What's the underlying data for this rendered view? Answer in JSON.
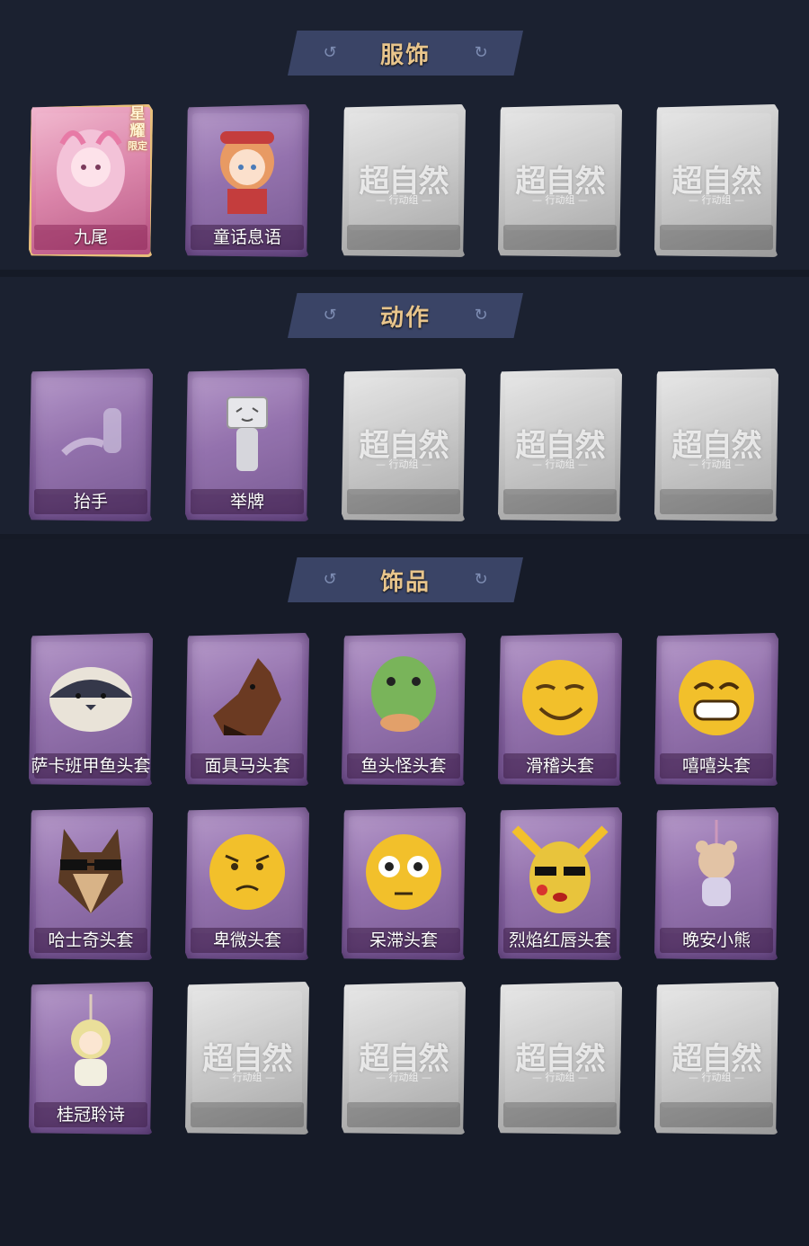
{
  "sections": [
    {
      "title": "服饰",
      "items": [
        {
          "name": "九尾",
          "state": "owned",
          "badge": [
            "星",
            "耀",
            "限定"
          ],
          "icon": "nine-tails-costume-icon"
        },
        {
          "name": "童话息语",
          "state": "owned",
          "icon": "fairy-tale-costume-icon"
        },
        {
          "name": "",
          "state": "locked"
        },
        {
          "name": "",
          "state": "locked"
        },
        {
          "name": "",
          "state": "locked"
        }
      ]
    },
    {
      "title": "动作",
      "items": [
        {
          "name": "抬手",
          "state": "owned",
          "icon": "raise-hand-action-icon"
        },
        {
          "name": "举牌",
          "state": "owned",
          "icon": "hold-sign-action-icon"
        },
        {
          "name": "",
          "state": "locked"
        },
        {
          "name": "",
          "state": "locked"
        },
        {
          "name": "",
          "state": "locked"
        }
      ]
    },
    {
      "title": "饰品",
      "items": [
        {
          "name": "萨卡班甲鱼头套",
          "state": "owned",
          "icon": "sacabambaspis-head-icon"
        },
        {
          "name": "面具马头套",
          "state": "owned",
          "icon": "horse-mask-icon"
        },
        {
          "name": "鱼头怪头套",
          "state": "owned",
          "icon": "fish-head-icon"
        },
        {
          "name": "滑稽头套",
          "state": "owned",
          "icon": "funny-face-icon"
        },
        {
          "name": "嘻嘻头套",
          "state": "owned",
          "icon": "grin-face-icon"
        },
        {
          "name": "哈士奇头套",
          "state": "owned",
          "icon": "husky-head-icon"
        },
        {
          "name": "卑微头套",
          "state": "owned",
          "icon": "humble-face-icon"
        },
        {
          "name": "呆滞头套",
          "state": "owned",
          "icon": "dazed-face-icon"
        },
        {
          "name": "烈焰红唇头套",
          "state": "owned",
          "icon": "red-lips-head-icon"
        },
        {
          "name": "晚安小熊",
          "state": "owned",
          "icon": "bear-charm-icon"
        },
        {
          "name": "桂冠聆诗",
          "state": "owned",
          "icon": "laurel-charm-icon"
        },
        {
          "name": "",
          "state": "locked"
        },
        {
          "name": "",
          "state": "locked"
        },
        {
          "name": "",
          "state": "locked"
        },
        {
          "name": "",
          "state": "locked"
        }
      ]
    }
  ],
  "locked_watermark": {
    "main": "超自然",
    "sub": "— 行动组 —"
  }
}
